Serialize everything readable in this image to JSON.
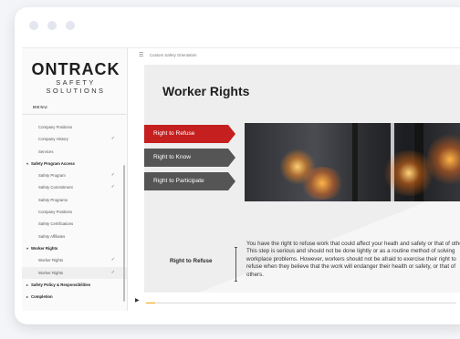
{
  "logo": {
    "main": "ONTRACK",
    "sub": "SAFETY SOLUTIONS"
  },
  "sidebar": {
    "menu_label": "MENU",
    "items": [
      {
        "label": "Company Positions",
        "type": "item",
        "check": ""
      },
      {
        "label": "Company History",
        "type": "item",
        "check": "✓"
      },
      {
        "label": "Services",
        "type": "item",
        "check": ""
      },
      {
        "label": "Safety Program Access",
        "type": "section",
        "caret": "▾",
        "check": ""
      },
      {
        "label": "Safety Program",
        "type": "item",
        "check": "✓"
      },
      {
        "label": "Safety Commitment",
        "type": "item",
        "check": "✓"
      },
      {
        "label": "Safety Programs",
        "type": "item",
        "check": ""
      },
      {
        "label": "Company Positions",
        "type": "item",
        "check": ""
      },
      {
        "label": "Safety Certifications",
        "type": "item",
        "check": ""
      },
      {
        "label": "Safety Affiliates",
        "type": "item",
        "check": ""
      },
      {
        "label": "Worker Rights",
        "type": "section",
        "caret": "▾",
        "check": ""
      },
      {
        "label": "Worker Rights",
        "type": "item",
        "check": "✓"
      },
      {
        "label": "Worker Rights",
        "type": "item",
        "active": true,
        "check": "✓"
      },
      {
        "label": "Safety Policy & Responsibilities",
        "type": "section",
        "caret": "▸",
        "check": ""
      },
      {
        "label": "Completion",
        "type": "section",
        "caret": "▸",
        "check": ""
      }
    ]
  },
  "topbar": {
    "course_title": "Custom Safety Orientation"
  },
  "slide": {
    "title": "Worker Rights",
    "tabs": [
      {
        "label": "Right to Refuse",
        "active": true
      },
      {
        "label": "Right to Know",
        "active": false
      },
      {
        "label": "Right to Participate",
        "active": false
      }
    ],
    "bottom_label": "Right to Refuse",
    "body": "You have the right to refuse work that could affect your heath and safety or that of others. This step is serious and should not be done lightly or as a routine method of solving workplace problems. However, workers should not be afraid to exercise their right to refuse when they believe that the work will endanger their health or safety, or that of others."
  },
  "player": {
    "progress": 0.03
  },
  "colors": {
    "accent_red": "#c51f1f",
    "tab_gray": "#555555",
    "progress": "#f0a400"
  },
  "icons": {
    "menu": "☰",
    "play": "▶",
    "replay": "↻",
    "volume": "◀"
  }
}
